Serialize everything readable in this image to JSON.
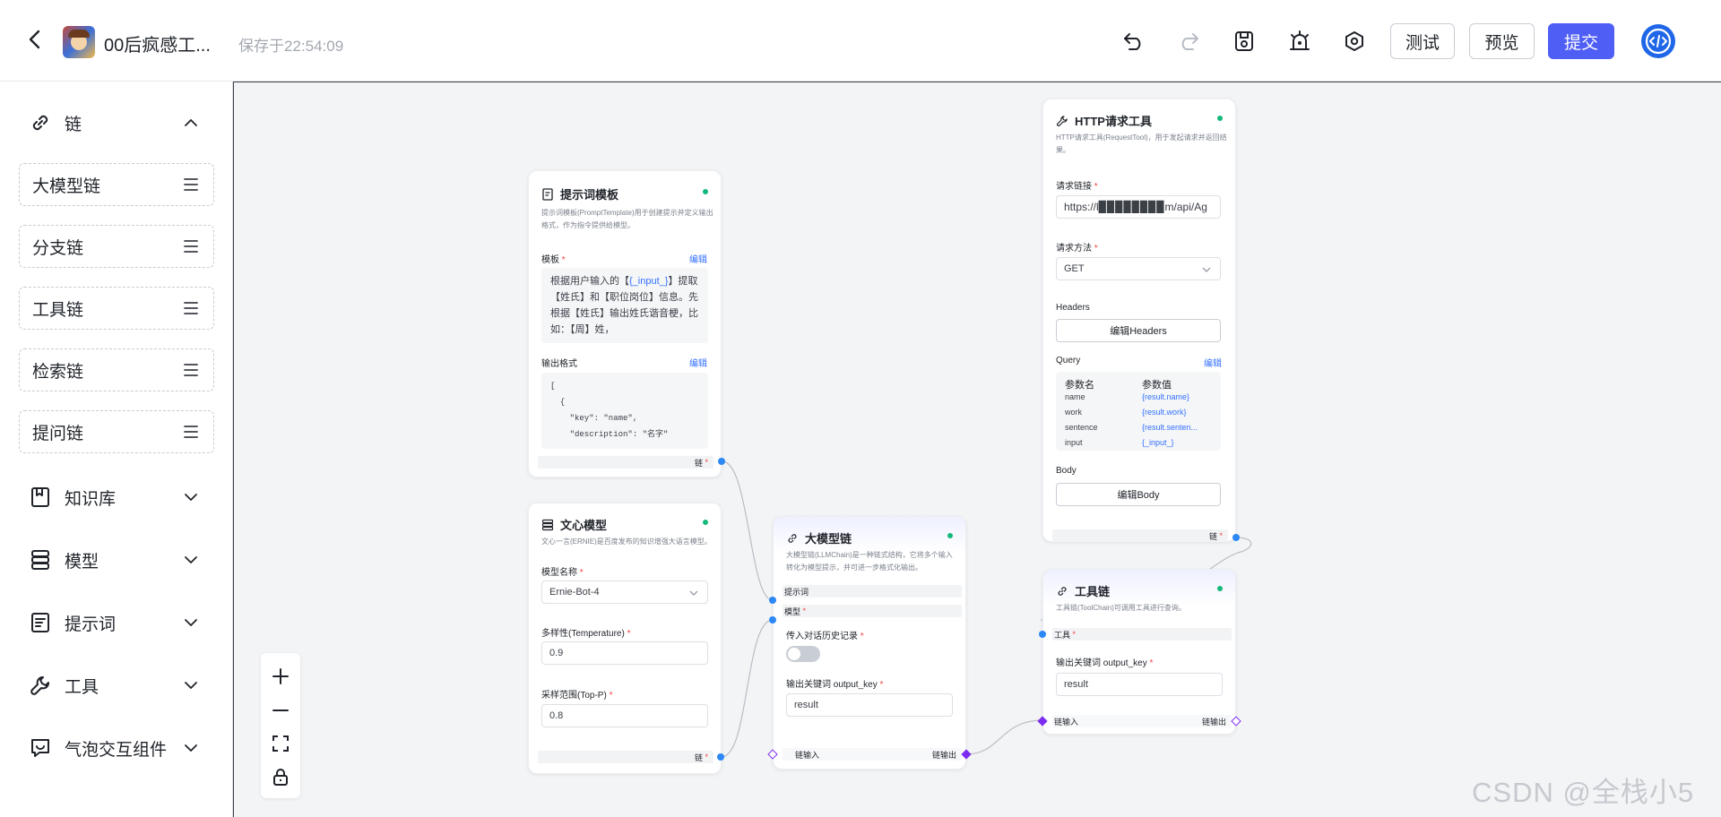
{
  "header": {
    "title": "00后疯感工...",
    "saved": "保存于22:54:09",
    "test_label": "测试",
    "preview_label": "预览",
    "submit_label": "提交"
  },
  "sidebar": {
    "chain_section": "链",
    "chain_items": [
      "大模型链",
      "分支链",
      "工具链",
      "检索链",
      "提问链"
    ],
    "sections": [
      "知识库",
      "模型",
      "提示词",
      "工具",
      "气泡交互组件"
    ]
  },
  "nodes": {
    "prompt": {
      "title": "提示词模板",
      "desc": "提示词模板(PromptTemplate)用于创建提示并定义输出格式，作为指令提供给模型。",
      "template_label": "模板",
      "edit": "编辑",
      "template_text_1": "根据用户输入的【",
      "template_var": "{_input_}",
      "template_text_2": "】提取【姓氏】和【职位岗位】信息。先根据【姓氏】输出姓氏谐音梗，比如：【周】姓，",
      "output_label": "输出格式",
      "output_lines": [
        "[",
        "  {",
        "    \"key\": \"name\",",
        "    \"description\": \"名字\""
      ],
      "chain_out": "链"
    },
    "model": {
      "title": "文心模型",
      "desc": "文心一言(ERNIE)是百度发布的知识增强大语言模型。",
      "model_name_label": "模型名称",
      "model_name_value": "Ernie-Bot-4",
      "temperature_label": "多样性(Temperature)",
      "temperature_value": "0.9",
      "top_p_label": "采样范围(Top-P)",
      "top_p_value": "0.8",
      "chain_out": "链"
    },
    "llmchain": {
      "title": "大模型链",
      "desc": "大模型链(LLMChain)是一种链式结构，它将多个输入转化为模型提示，并可进一步格式化输出。",
      "prompt_port": "提示词",
      "model_port": "模型",
      "history_label": "传入对话历史记录",
      "output_key_label": "输出关键词 output_key",
      "output_key_value": "result",
      "chain_in": "链输入",
      "chain_out": "链输出"
    },
    "http": {
      "title": "HTTP请求工具",
      "desc": "HTTP请求工具(RequestTool)，用于发起请求并返回结果。",
      "url_label": "请求链接",
      "url_value": "https://l▉▉▉▉▉▉▉▉m/api/Ag",
      "method_label": "请求方法",
      "method_value": "GET",
      "headers_label": "Headers",
      "headers_btn": "编辑Headers",
      "query_label": "Query",
      "edit": "编辑",
      "query_head_key": "参数名",
      "query_head_val": "参数值",
      "query_rows": [
        {
          "k": "name",
          "v": "{result.name}"
        },
        {
          "k": "work",
          "v": "{result.work}"
        },
        {
          "k": "sentence",
          "v": "{result.senten..."
        },
        {
          "k": "input",
          "v": "{_input_}"
        }
      ],
      "body_label": "Body",
      "body_btn": "编辑Body",
      "chain_out": "链"
    },
    "toolchain": {
      "title": "工具链",
      "desc": "工具链(ToolChain)可调用工具进行查询。",
      "tool_port": "工具",
      "output_key_label": "输出关键词 output_key",
      "output_key_value": "result",
      "chain_in": "链输入",
      "chain_out": "链输出"
    }
  },
  "watermark": "CSDN @全栈小5",
  "colors": {
    "primary": "#4f5ef5",
    "port": "#2b88f5",
    "chain_port": "#7c2cf0",
    "status": "#14b87b"
  }
}
